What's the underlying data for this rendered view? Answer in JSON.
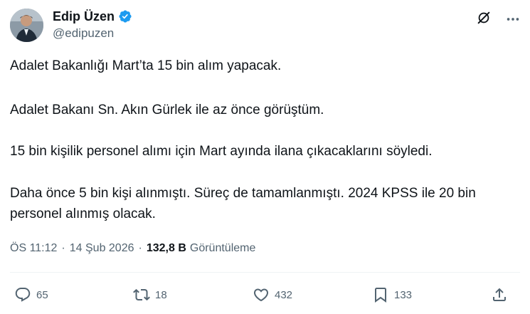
{
  "author": {
    "name": "Edip Üzen",
    "handle": "@edipuzen"
  },
  "icons": {
    "avatar": "avatar",
    "verified": "verified-badge-icon",
    "grok": "grok-icon",
    "more": "more-options-icon"
  },
  "tweet": {
    "paragraphs": [
      "Adalet Bakanlığı Mart’ta 15 bin alım yapacak.",
      "Adalet Bakanı Sn. Akın Gürlek ile az önce görüştüm.",
      "15 bin kişilik personel alımı için Mart ayında ilana çıkacaklarını söyledi.",
      "Daha önce 5 bin kişi alınmıştı. Süreç de tamamlanmıştı. 2024 KPSS ile 20 bin personel alınmış olacak."
    ]
  },
  "meta": {
    "time": "ÖS 11:12",
    "separator1": "·",
    "date": "14 Şub 2026",
    "separator2": "·",
    "views_count": "132,8 B",
    "views_label": "Görüntüleme"
  },
  "actions": {
    "replies": "65",
    "reposts": "18",
    "likes": "432",
    "bookmarks": "133"
  },
  "colors": {
    "verified": "#1d9bf0",
    "secondary_text": "#536471",
    "primary_text": "#0f1419"
  }
}
